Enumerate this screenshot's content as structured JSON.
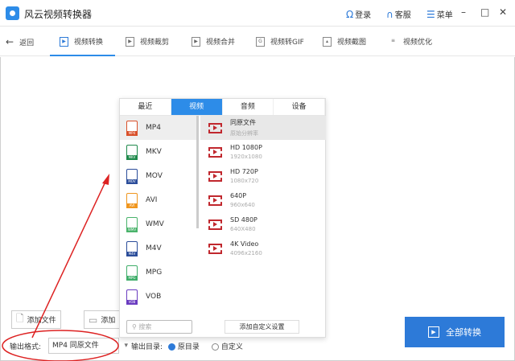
{
  "app": {
    "title": "风云视频转换器",
    "login": "登录",
    "service": "客服",
    "menu": "菜单"
  },
  "toolbar": {
    "back": "返回",
    "items": [
      "视频转换",
      "视频裁剪",
      "视频合并",
      "视频转GIF",
      "视频截图",
      "视频优化"
    ]
  },
  "popup": {
    "tabs": [
      "最近",
      "视频",
      "音频",
      "设备"
    ],
    "formats": [
      {
        "name": "MP4",
        "color": "#d9502a"
      },
      {
        "name": "MKV",
        "color": "#1f8a4c"
      },
      {
        "name": "MOV",
        "color": "#2b4d9a"
      },
      {
        "name": "AVI",
        "color": "#f0961e"
      },
      {
        "name": "WMV",
        "color": "#4ab36b"
      },
      {
        "name": "M4V",
        "color": "#2b4d9a"
      },
      {
        "name": "MPG",
        "color": "#3fae6a"
      },
      {
        "name": "VOB",
        "color": "#6a3cc0"
      }
    ],
    "presets": [
      {
        "name": "同原文件",
        "sub": "原始分辨率"
      },
      {
        "name": "HD 1080P",
        "sub": "1920x1080"
      },
      {
        "name": "HD 720P",
        "sub": "1080x720"
      },
      {
        "name": "640P",
        "sub": "960x640"
      },
      {
        "name": "SD 480P",
        "sub": "640X480"
      },
      {
        "name": "4K Video",
        "sub": "4096x2160"
      }
    ],
    "search_placeholder": "搜索",
    "custom": "添加自定义设置"
  },
  "bottom": {
    "add_file": "添加文件",
    "add_folder": "添加",
    "format_label": "输出格式:",
    "format_value": "MP4 同原文件",
    "dir_label": "输出目录:",
    "dir_original": "原目录",
    "dir_custom": "自定义",
    "convert": "全部转换"
  }
}
